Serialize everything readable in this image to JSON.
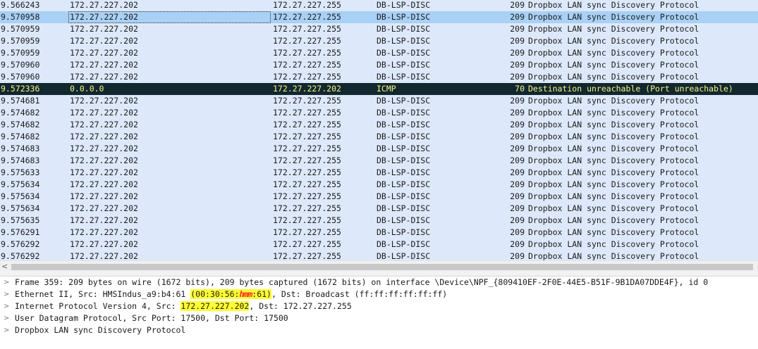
{
  "packets": [
    {
      "time": "9.566243",
      "src": "172.27.227.202",
      "dst": "172.27.227.255",
      "proto": "DB-LSP-DISC",
      "len": "209",
      "info": "Dropbox LAN sync Discovery Protocol"
    },
    {
      "time": "9.570958",
      "src": "172.27.227.202",
      "dst": "172.27.227.255",
      "proto": "DB-LSP-DISC",
      "len": "209",
      "info": "Dropbox LAN sync Discovery Protocol"
    },
    {
      "time": "9.570959",
      "src": "172.27.227.202",
      "dst": "172.27.227.255",
      "proto": "DB-LSP-DISC",
      "len": "209",
      "info": "Dropbox LAN sync Discovery Protocol"
    },
    {
      "time": "9.570959",
      "src": "172.27.227.202",
      "dst": "172.27.227.255",
      "proto": "DB-LSP-DISC",
      "len": "209",
      "info": "Dropbox LAN sync Discovery Protocol"
    },
    {
      "time": "9.570959",
      "src": "172.27.227.202",
      "dst": "172.27.227.255",
      "proto": "DB-LSP-DISC",
      "len": "209",
      "info": "Dropbox LAN sync Discovery Protocol"
    },
    {
      "time": "9.570960",
      "src": "172.27.227.202",
      "dst": "172.27.227.255",
      "proto": "DB-LSP-DISC",
      "len": "209",
      "info": "Dropbox LAN sync Discovery Protocol"
    },
    {
      "time": "9.570960",
      "src": "172.27.227.202",
      "dst": "172.27.227.255",
      "proto": "DB-LSP-DISC",
      "len": "209",
      "info": "Dropbox LAN sync Discovery Protocol"
    },
    {
      "time": "9.572336",
      "src": "0.0.0.0",
      "dst": "172.27.227.202",
      "proto": "ICMP",
      "len": "70",
      "info": "Destination unreachable (Port unreachable)"
    },
    {
      "time": "9.574681",
      "src": "172.27.227.202",
      "dst": "172.27.227.255",
      "proto": "DB-LSP-DISC",
      "len": "209",
      "info": "Dropbox LAN sync Discovery Protocol"
    },
    {
      "time": "9.574682",
      "src": "172.27.227.202",
      "dst": "172.27.227.255",
      "proto": "DB-LSP-DISC",
      "len": "209",
      "info": "Dropbox LAN sync Discovery Protocol"
    },
    {
      "time": "9.574682",
      "src": "172.27.227.202",
      "dst": "172.27.227.255",
      "proto": "DB-LSP-DISC",
      "len": "209",
      "info": "Dropbox LAN sync Discovery Protocol"
    },
    {
      "time": "9.574682",
      "src": "172.27.227.202",
      "dst": "172.27.227.255",
      "proto": "DB-LSP-DISC",
      "len": "209",
      "info": "Dropbox LAN sync Discovery Protocol"
    },
    {
      "time": "9.574683",
      "src": "172.27.227.202",
      "dst": "172.27.227.255",
      "proto": "DB-LSP-DISC",
      "len": "209",
      "info": "Dropbox LAN sync Discovery Protocol"
    },
    {
      "time": "9.574683",
      "src": "172.27.227.202",
      "dst": "172.27.227.255",
      "proto": "DB-LSP-DISC",
      "len": "209",
      "info": "Dropbox LAN sync Discovery Protocol"
    },
    {
      "time": "9.575633",
      "src": "172.27.227.202",
      "dst": "172.27.227.255",
      "proto": "DB-LSP-DISC",
      "len": "209",
      "info": "Dropbox LAN sync Discovery Protocol"
    },
    {
      "time": "9.575634",
      "src": "172.27.227.202",
      "dst": "172.27.227.255",
      "proto": "DB-LSP-DISC",
      "len": "209",
      "info": "Dropbox LAN sync Discovery Protocol"
    },
    {
      "time": "9.575634",
      "src": "172.27.227.202",
      "dst": "172.27.227.255",
      "proto": "DB-LSP-DISC",
      "len": "209",
      "info": "Dropbox LAN sync Discovery Protocol"
    },
    {
      "time": "9.575634",
      "src": "172.27.227.202",
      "dst": "172.27.227.255",
      "proto": "DB-LSP-DISC",
      "len": "209",
      "info": "Dropbox LAN sync Discovery Protocol"
    },
    {
      "time": "9.575635",
      "src": "172.27.227.202",
      "dst": "172.27.227.255",
      "proto": "DB-LSP-DISC",
      "len": "209",
      "info": "Dropbox LAN sync Discovery Protocol"
    },
    {
      "time": "9.576291",
      "src": "172.27.227.202",
      "dst": "172.27.227.255",
      "proto": "DB-LSP-DISC",
      "len": "209",
      "info": "Dropbox LAN sync Discovery Protocol"
    },
    {
      "time": "9.576292",
      "src": "172.27.227.202",
      "dst": "172.27.227.255",
      "proto": "DB-LSP-DISC",
      "len": "209",
      "info": "Dropbox LAN sync Discovery Protocol"
    },
    {
      "time": "9.576292",
      "src": "172.27.227.202",
      "dst": "172.27.227.255",
      "proto": "DB-LSP-DISC",
      "len": "209",
      "info": "Dropbox LAN sync Discovery Protocol"
    }
  ],
  "selected_index": 1,
  "icmp_index": 7,
  "colors": {
    "row_bg": "#dde9fb",
    "selected_bg": "#a9d0f5",
    "icmp_bg": "#12272e",
    "icmp_fg": "#f7f785",
    "highlight": "#ffff33",
    "redaction": "#ff2020"
  },
  "scrollbar": {
    "left_arrow_icon": "chevron-left-icon",
    "left_arrow_glyph": "<"
  },
  "details": {
    "expander_icon": "chevron-right-icon",
    "expander_glyph": ">",
    "frame": "Frame 359: 209 bytes on wire (1672 bits), 209 bytes captured (1672 bits) on interface \\Device\\NPF_{809410EF-2F0E-44E5-B51F-9B1DA07DDE4F}, id 0",
    "ethernet": {
      "prefix": "Ethernet II, Src: HMSIndus_a9:b4:61 ",
      "mac_open": "(00:30:56:",
      "mac_redacted": "hmm",
      "mac_close": ":61)",
      "suffix": ", Dst: Broadcast (ff:ff:ff:ff:ff:ff)"
    },
    "ip": {
      "prefix": "Internet Protocol Version 4, Src: ",
      "src": "172.27.227.202",
      "suffix": ", Dst: 172.27.227.255"
    },
    "udp": "User Datagram Protocol, Src Port: 17500, Dst Port: 17500",
    "dropbox": "Dropbox LAN sync Discovery Protocol"
  }
}
